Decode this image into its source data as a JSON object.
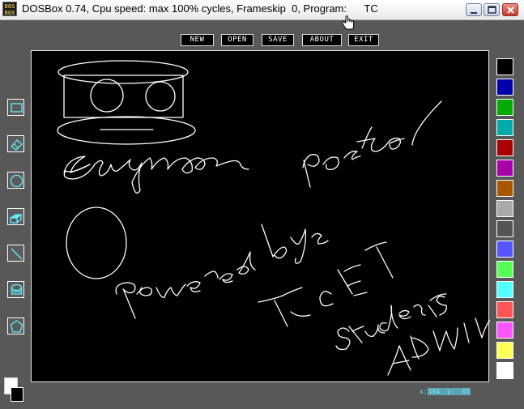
{
  "window": {
    "title": "DOSBox 0.74, Cpu speed: max 100% cycles, Frameskip  0, Program:      TC",
    "icon_text": "DOS BOX"
  },
  "menu": {
    "new": "NEW",
    "open": "OPEN",
    "save": "SAVE",
    "about": "ABOUT",
    "exit": "EXIT"
  },
  "tools": [
    {
      "name": "rectangle-tool",
      "icon": "rectangle-icon"
    },
    {
      "name": "eraser-tool",
      "icon": "eraser-icon"
    },
    {
      "name": "circle-tool",
      "icon": "circle-icon"
    },
    {
      "name": "fill-tool",
      "icon": "paint-bucket-icon"
    },
    {
      "name": "line-tool",
      "icon": "line-icon"
    },
    {
      "name": "ellipse-tool",
      "icon": "cylinder-icon"
    },
    {
      "name": "polygon-tool",
      "icon": "pentagon-icon"
    }
  ],
  "palette": [
    "#000000",
    "#0000aa",
    "#00aa00",
    "#00aaaa",
    "#aa0000",
    "#aa00aa",
    "#aa5500",
    "#aaaaaa",
    "#555555",
    "#5555ff",
    "#55ff55",
    "#55ffff",
    "#ff5555",
    "#ff55ff",
    "#ffff55",
    "#ffffff"
  ],
  "current_colors": {
    "foreground": "#ffffff",
    "background": "#000000"
  },
  "status": {
    "x_label": "x:",
    "x_value": "564",
    "y_label": "y:",
    "y_value": "65"
  }
}
